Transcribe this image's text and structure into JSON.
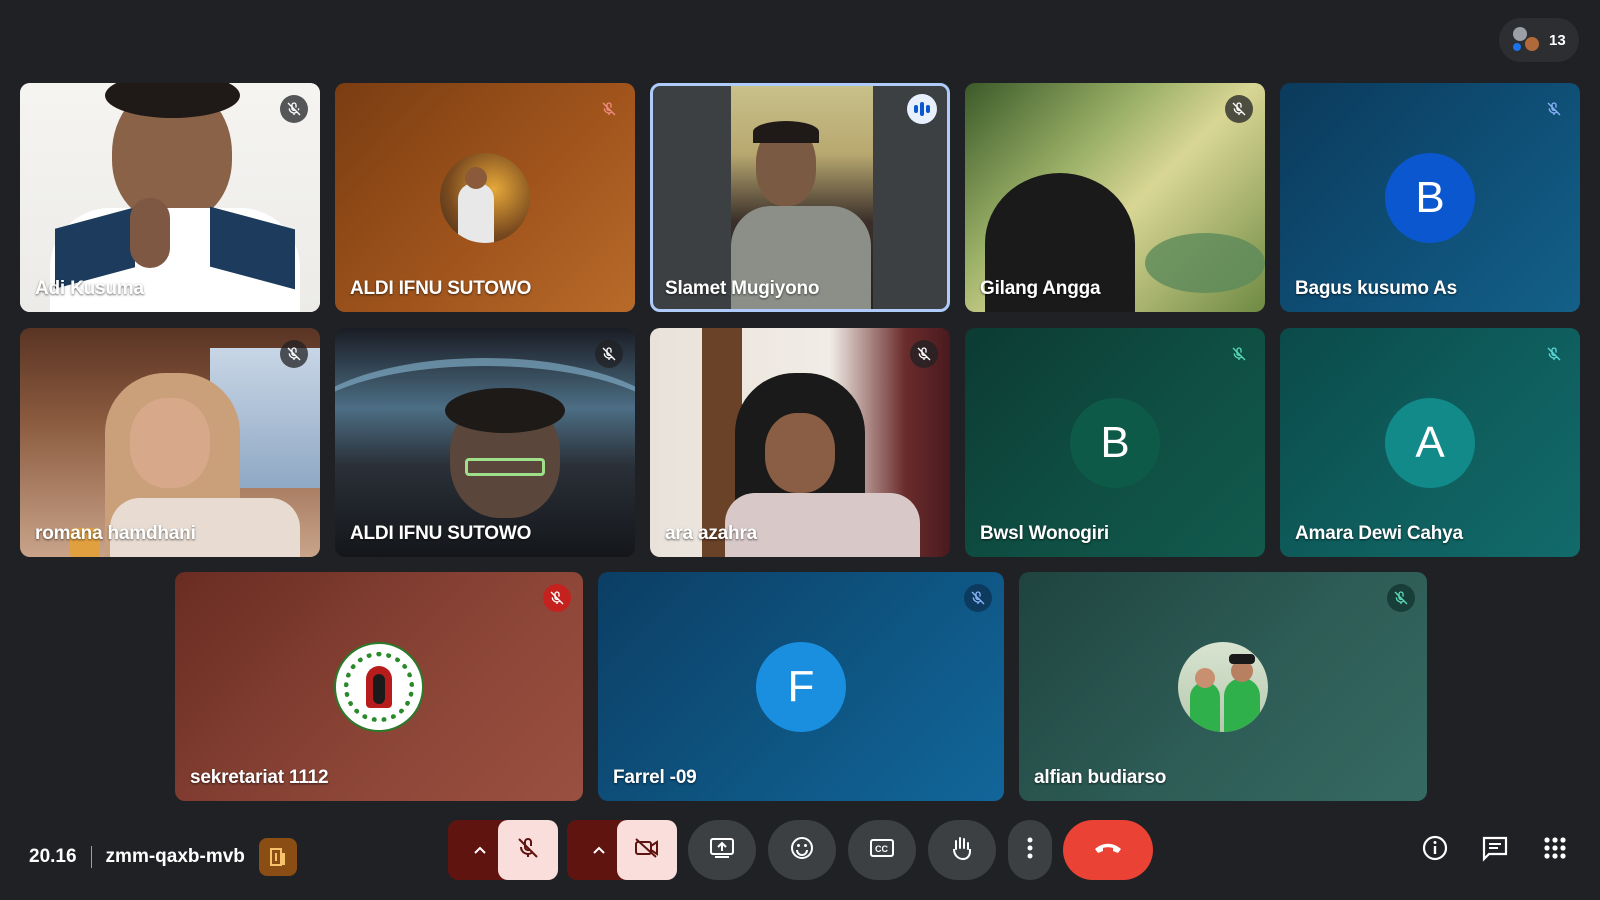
{
  "participant_count": "13",
  "meeting": {
    "time": "20.16",
    "code": "zmm-qaxb-mvb"
  },
  "tiles": [
    {
      "name": "Adi Kusuma"
    },
    {
      "name": "ALDI IFNU SUTOWO"
    },
    {
      "name": "Slamet Mugiyono"
    },
    {
      "name": "Gilang Angga"
    },
    {
      "name": "Bagus kusumo As",
      "initial": "B",
      "avatar_color": "#0b57d0"
    },
    {
      "name": "romana hamdhani"
    },
    {
      "name": "ALDI IFNU SUTOWO"
    },
    {
      "name": "ara azahra"
    },
    {
      "name": "Bwsl Wonogiri",
      "initial": "B",
      "avatar_color": "#0e5a49"
    },
    {
      "name": "Amara Dewi Cahya",
      "initial": "A",
      "avatar_color": "#128a8a"
    },
    {
      "name": "sekretariat 1112"
    },
    {
      "name": "Farrel -09",
      "initial": "F",
      "avatar_color": "#1a8fe0"
    },
    {
      "name": "alfian budiarso"
    }
  ],
  "icons": {
    "people": "people-icon",
    "mic_off": "mic-off-icon",
    "camera_off": "camera-off-icon",
    "present": "present-screen-icon",
    "emoji": "emoji-icon",
    "captions": "captions-icon",
    "raise_hand": "raise-hand-icon",
    "more": "more-options-icon",
    "end_call": "end-call-icon",
    "info": "info-icon",
    "chat": "chat-icon",
    "activities": "activities-icon"
  },
  "colors": {
    "end_call": "#ea4335",
    "muted_control": "#f9dedc",
    "muted_arrow": "#601410",
    "background": "#202124"
  }
}
